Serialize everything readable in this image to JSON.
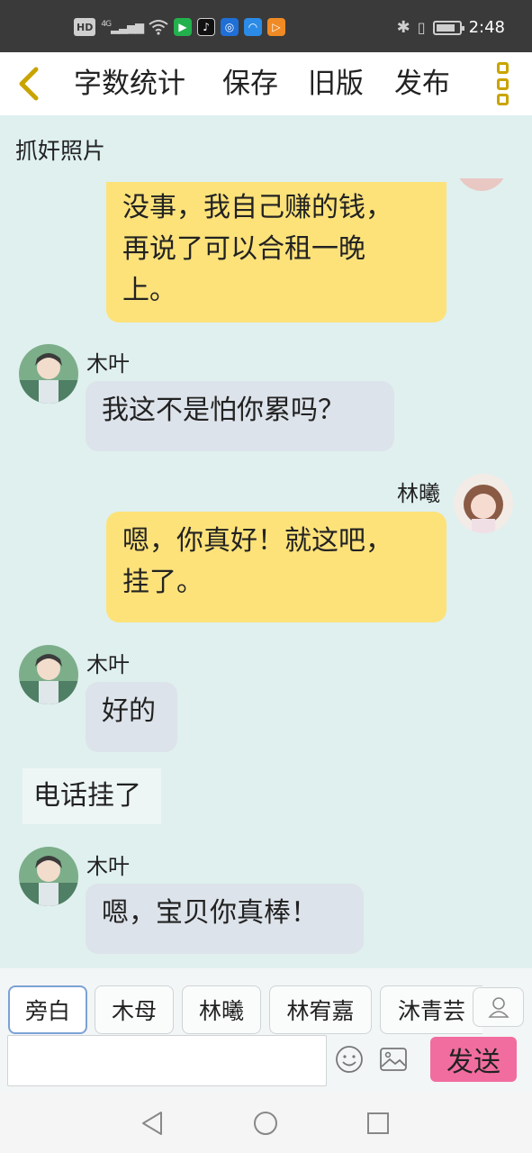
{
  "status_bar": {
    "hd_badge": "HD",
    "network": "4G",
    "time": "2:48",
    "battery_level": 0.85,
    "app_icons": [
      "video-app-icon",
      "tiktok-icon",
      "browser-icon",
      "cloud-app-icon",
      "play-app-icon"
    ]
  },
  "toolbar": {
    "word_count_label": "字数统计",
    "save_label": "保存",
    "old_version_label": "旧版",
    "publish_label": "发布",
    "accent_color": "#c9a400"
  },
  "chat": {
    "title": "抓奸照片",
    "messages": [
      {
        "type": "right",
        "text_lines": [
          "没事，我自己赚的钱，",
          "再说了可以合租一晚",
          "上。"
        ]
      },
      {
        "type": "left",
        "name": "木叶",
        "text": "我这不是怕你累吗？"
      },
      {
        "type": "right",
        "name": "林曦",
        "text_lines": [
          "嗯，你真好！就这吧，",
          "挂了。"
        ]
      },
      {
        "type": "left",
        "name": "木叶",
        "text": "好的"
      },
      {
        "type": "narration",
        "text": "电话挂了"
      },
      {
        "type": "left",
        "name": "木叶",
        "text": "嗯，宝贝你真棒！"
      }
    ]
  },
  "bottom_panel": {
    "characters": [
      "旁白",
      "木母",
      "林曦",
      "林宥嘉",
      "沐青芸"
    ],
    "selected_character": "旁白",
    "input_value": "",
    "send_label": "发送",
    "send_color": "#f26d9f"
  }
}
